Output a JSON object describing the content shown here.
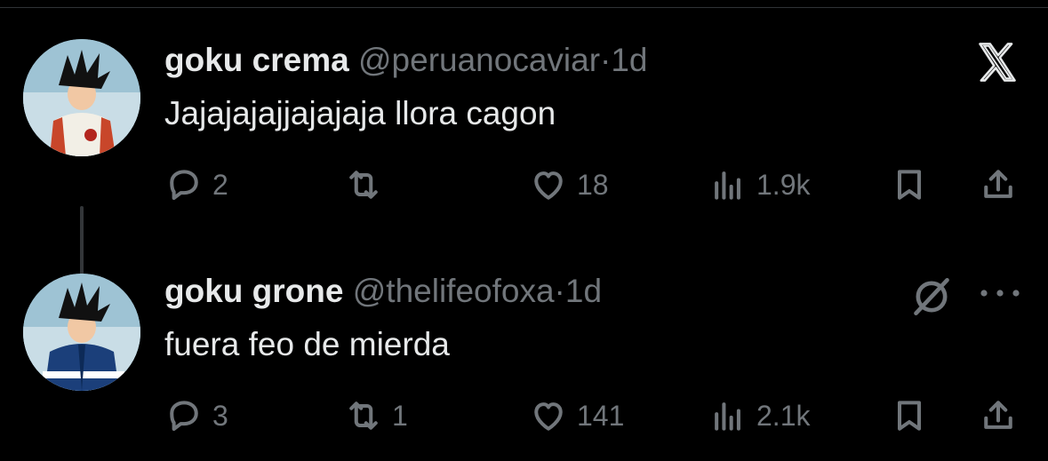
{
  "tweets": [
    {
      "name": "goku crema",
      "handle": "@peruanocaviar",
      "separator": "·",
      "time": "1d",
      "text": "Jajajajajjajajaja llora cagon",
      "replies": "2",
      "retweets": "",
      "likes": "18",
      "views": "1.9k"
    },
    {
      "name": "goku grone",
      "handle": "@thelifeofoxa",
      "separator": "·",
      "time": "1d",
      "text": "fuera feo de mierda",
      "replies": "3",
      "retweets": "1",
      "likes": "141",
      "views": "2.1k"
    }
  ],
  "icons": {
    "brand": "x-logo-icon",
    "reply": "reply-icon",
    "retweet": "retweet-icon",
    "like": "heart-icon",
    "views": "views-icon",
    "bookmark": "bookmark-icon",
    "share": "share-icon",
    "mute": "mute-icon",
    "more": "more-icon"
  },
  "colors": {
    "background": "#000000",
    "text": "#e7e9ea",
    "secondary": "#71767b",
    "thread_line": "#333639"
  }
}
